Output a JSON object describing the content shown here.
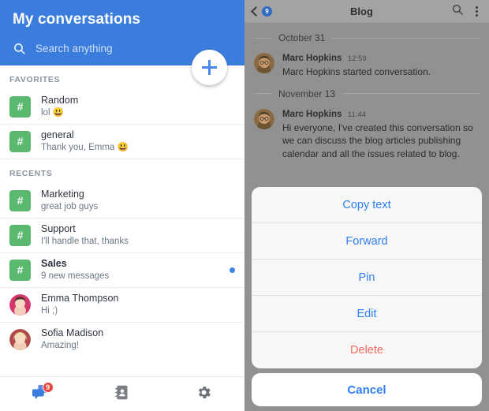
{
  "colors": {
    "header_blue": "#3b7ddd",
    "accent_blue": "#2f7ff5",
    "channel_green": "#5bb96f",
    "destructive_red": "#fa6a60",
    "badge_red": "#e8453c",
    "overlay_gray": "#919191"
  },
  "left": {
    "title": "My conversations",
    "search": {
      "placeholder": "Search anything",
      "value": "",
      "icon": "search-icon"
    },
    "fab": {
      "icon": "plus-icon",
      "label": "+"
    },
    "sections": [
      {
        "label": "FAVORITES",
        "items": [
          {
            "type": "channel",
            "glyph": "#",
            "name": "Random",
            "preview": "lol 😃",
            "unread": false
          },
          {
            "type": "channel",
            "glyph": "#",
            "name": "general",
            "preview": "Thank you, Emma 😃",
            "unread": false
          }
        ]
      },
      {
        "label": "RECENTS",
        "items": [
          {
            "type": "channel",
            "glyph": "#",
            "name": "Marketing",
            "preview": "great job guys",
            "unread": false
          },
          {
            "type": "channel",
            "glyph": "#",
            "name": "Support",
            "preview": "I'll handle that, thanks",
            "unread": false
          },
          {
            "type": "channel",
            "glyph": "#",
            "name": "Sales",
            "preview": "9 new messages",
            "unread": true
          },
          {
            "type": "person",
            "name": "Emma Thompson",
            "preview": "Hi ;)",
            "unread": false
          },
          {
            "type": "person",
            "name": "Sofia Madison",
            "preview": "Amazing!",
            "unread": false
          }
        ]
      }
    ],
    "bottom_nav": [
      {
        "icon": "chat-bubble-icon",
        "badge": "9",
        "active": true
      },
      {
        "icon": "contacts-icon",
        "badge": "",
        "active": false
      },
      {
        "icon": "gear-icon",
        "badge": "",
        "active": false
      }
    ]
  },
  "right": {
    "topbar": {
      "back_icon": "chevron-left-icon",
      "back_badge": "9",
      "title": "Blog",
      "search_icon": "search-icon",
      "menu_icon": "kebab-menu-icon"
    },
    "messages": [
      {
        "kind": "date",
        "text": "October 31"
      },
      {
        "kind": "message",
        "author": "Marc Hopkins",
        "time": "12:59",
        "text": "Marc Hopkins started conversation."
      },
      {
        "kind": "date",
        "text": "November 13"
      },
      {
        "kind": "message",
        "author": "Marc Hopkins",
        "time": "11:44",
        "text": "Hi everyone, I've created this conversation so we can discuss the blog articles publishing calendar and all the issues related to blog."
      }
    ],
    "action_sheet": {
      "items": [
        {
          "label": "Copy text",
          "style": "default"
        },
        {
          "label": "Forward",
          "style": "default"
        },
        {
          "label": "Pin",
          "style": "default"
        },
        {
          "label": "Edit",
          "style": "default"
        },
        {
          "label": "Delete",
          "style": "destructive"
        }
      ],
      "cancel": "Cancel"
    }
  }
}
